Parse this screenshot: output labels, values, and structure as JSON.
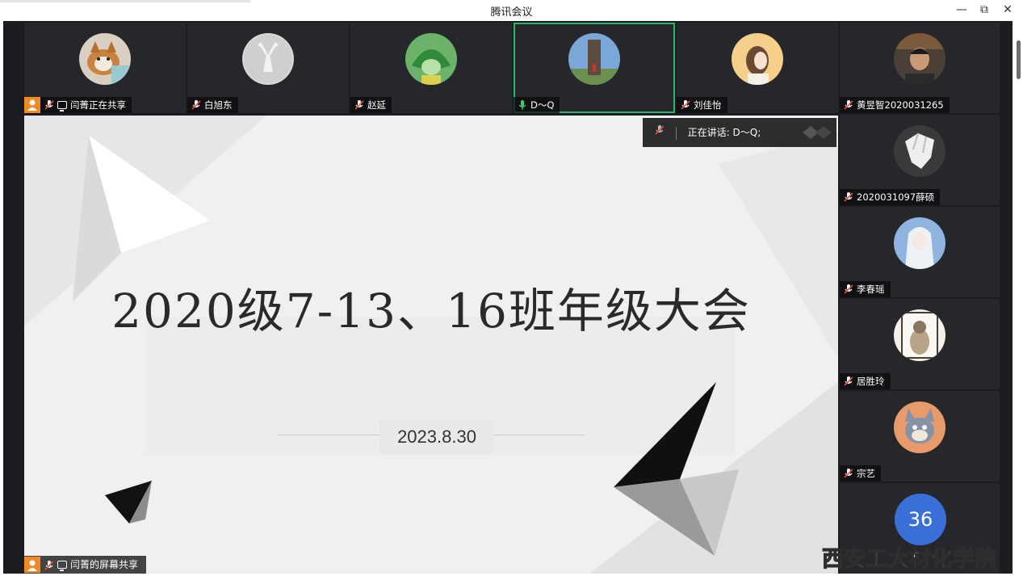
{
  "window": {
    "title": "腾讯会议",
    "controls": {
      "minimize": "—",
      "restore": "⧉",
      "close": "✕"
    }
  },
  "participants_top": [
    {
      "name": "闫菁正在共享",
      "host": true,
      "sharing": true,
      "muted": true,
      "avatar": "dog-avatar"
    },
    {
      "name": "白旭东",
      "muted": true,
      "avatar": "deer-sculpture-avatar"
    },
    {
      "name": "赵延",
      "muted": true,
      "avatar": "green-hood-avatar"
    },
    {
      "name": "D～Q",
      "muted": false,
      "speaking": true,
      "avatar": "tower-photo-avatar"
    },
    {
      "name": "刘佳怡",
      "muted": true,
      "avatar": "girl-illustration-avatar"
    }
  ],
  "participants_side": [
    {
      "name": "黄昱智2020031265",
      "muted": true,
      "avatar": "man-photo-avatar"
    },
    {
      "name": "2020031097薛硕",
      "muted": true,
      "avatar": "anime-sketch-avatar"
    },
    {
      "name": "李春瑶",
      "muted": true,
      "avatar": "anime-girl-avatar"
    },
    {
      "name": "居胜玲",
      "muted": true,
      "avatar": "cartoon-bear-avatar"
    },
    {
      "name": "宗艺",
      "muted": true,
      "avatar": "tom-cat-avatar"
    }
  ],
  "more_count": "36",
  "speaking_indicator": {
    "label": "正在讲话:  D～Q;"
  },
  "share": {
    "label": "闫菁的屏幕共享",
    "slide_title": "2020级7-13、16班年级大会",
    "slide_date": "2023.8.30"
  },
  "watermark": "西安工大材化学院",
  "colors": {
    "active_border": "#2fb36b",
    "host_badge": "#f08a24",
    "count_badge": "#3a6fd8"
  }
}
